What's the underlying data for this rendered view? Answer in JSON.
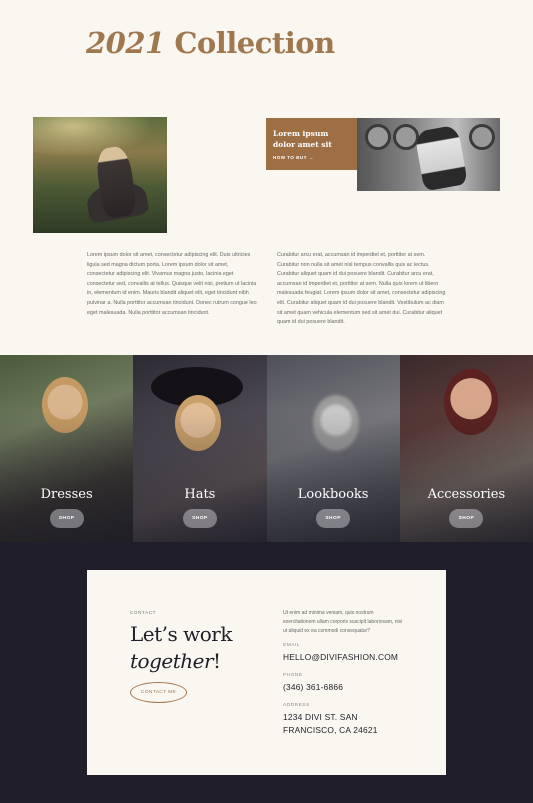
{
  "header": {
    "title_year": "2021",
    "title_rest": " Collection"
  },
  "promo": {
    "title": "Lorem ipsum dolor amet sit",
    "link": "HOW TO BUY →"
  },
  "body": {
    "left": "Lorem ipsum dolor sit amet, consectetur adipiscing elit. Duis ultricies ligula sed magna dictum porta. Lorem ipsum dolor sit amet, consectetur adipiscing elit. Vivamus magna justo, lacinia eget consectetur sed, convallis at tellus. Quisque velit nisi, pretium ut lacinia in, elementum id enim. Mauris blandit aliquet elit, eget tincidunt nibh pulvinar a. Nulla porttitor accumsan tincidunt. Donec rutrum congue leo eget malesuada. Nulla porttitor accumsan tincidunt.",
    "right": "Curabitur arcu erat, accumsan id imperdiet et, porttitor at sem. Curabitur non nulla sit amet nisl tempus convallis quis ac lectus. Curabitur aliquet quam id dui posuere blandit. Curabitur arcu erat, accumsan id imperdiet et, porttitor at sem. Nulla quis lorem ut libero malesuada feugiat. Lorem ipsum dolor sit amet, consectetur adipiscing elit. Curabitur aliquet quam id dui posuere blandit. Vestibulum ac diam sit amet quam vehicula elementum sed sit amet dui. Curabitur aliquet quam id dui posuere blandit."
  },
  "categories": [
    {
      "label": "Dresses",
      "button": "SHOP"
    },
    {
      "label": "Hats",
      "button": "SHOP"
    },
    {
      "label": "Lookbooks",
      "button": "SHOP"
    },
    {
      "label": "Accessories",
      "button": "SHOP"
    }
  ],
  "contact": {
    "eyebrow": "CONTACT",
    "heading_line1": "Let’s work",
    "heading_line2_italic": "together",
    "heading_line2_end": "!",
    "button": "CONTACT ME",
    "description": "Ut enim ad minima veniam, quis nostrum exercitationem ullam corporis suscipit laboriosam, nisi ut aliquid ex ea commodi consequatur?",
    "email_label": "EMAIL",
    "email": "HELLO@DIVIFASHION.COM",
    "phone_label": "PHONE",
    "phone": "(346) 361-6866",
    "address_label": "ADDRESS",
    "address_line1": "1234 DIVI ST. SAN",
    "address_line2": "FRANCISCO, CA 24621"
  },
  "colors": {
    "accent": "#a07850",
    "promo_bg": "#9e6e45",
    "page_bg": "#faf6f0",
    "footer_bg": "#1f1e2a"
  }
}
